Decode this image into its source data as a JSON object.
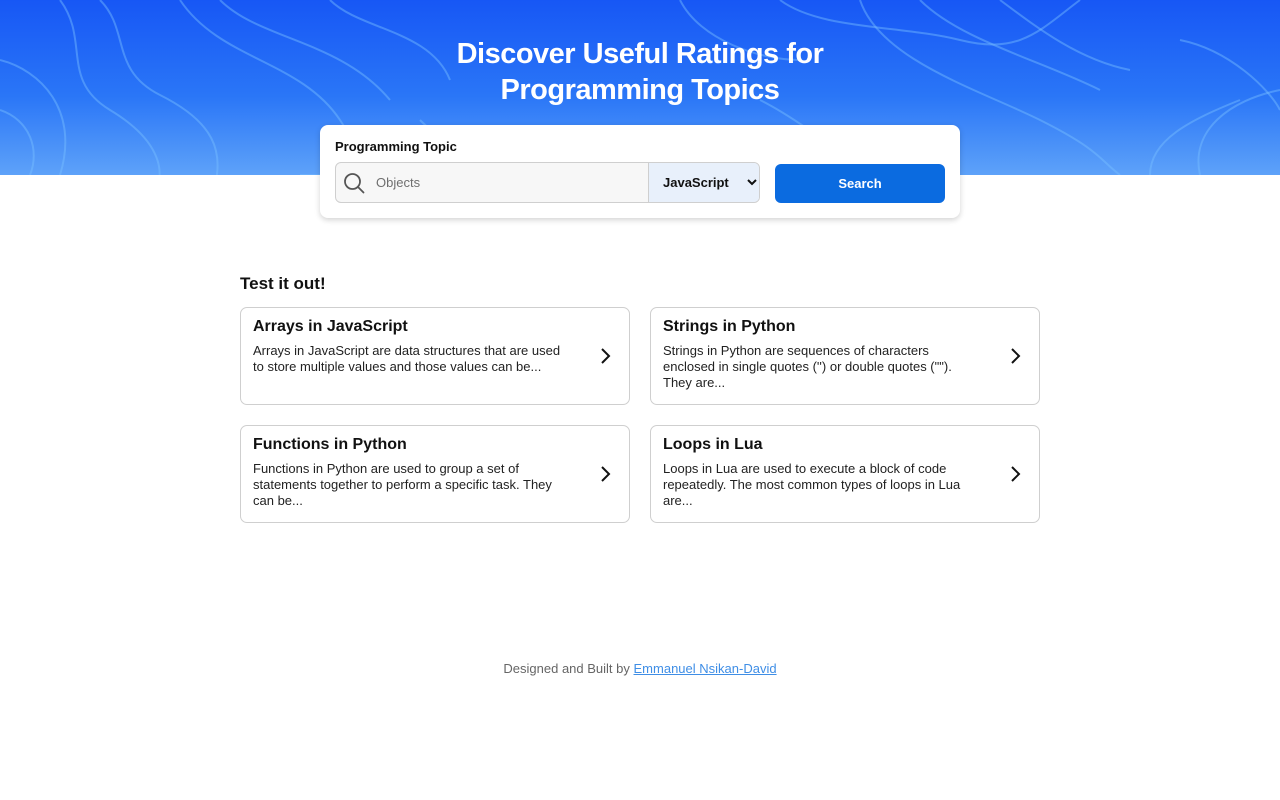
{
  "colors": {
    "hero_gradient_top": "#1757f5",
    "hero_gradient_bottom": "#5ea2f9",
    "button": "#0b6be0",
    "link": "#3f8ee6"
  },
  "hero": {
    "title_line1": "Discover Useful Ratings for",
    "title_line2": "Programming Topics"
  },
  "search": {
    "label": "Programming Topic",
    "placeholder": "Objects",
    "value": "",
    "language_selected": "JavaScript",
    "button_label": "Search",
    "icon": "search-icon"
  },
  "test_section": {
    "title": "Test it out!",
    "cards": [
      {
        "title": "Arrays in JavaScript",
        "description": "Arrays in JavaScript are data structures that are used to store multiple values and those values can be...",
        "icon": "chevron-right-icon"
      },
      {
        "title": "Strings in Python",
        "description": "Strings in Python are sequences of characters enclosed in single quotes ('') or double quotes (\"\"). They are...",
        "icon": "chevron-right-icon"
      },
      {
        "title": "Functions in Python",
        "description": "Functions in Python are used to group a set of statements together to perform a specific task. They can be...",
        "icon": "chevron-right-icon"
      },
      {
        "title": "Loops in Lua",
        "description": "Loops in Lua are used to execute a block of code repeatedly. The most common types of loops in Lua are...",
        "icon": "chevron-right-icon"
      }
    ]
  },
  "footer": {
    "prefix": "Designed and Built by",
    "author_link": "Emmanuel Nsikan-David"
  }
}
